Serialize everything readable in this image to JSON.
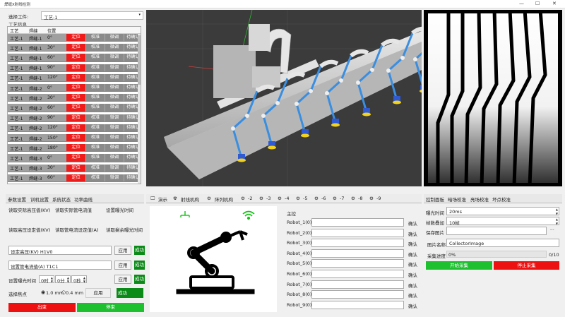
{
  "window": {
    "title": "焊缝X射线检测",
    "min": "—",
    "max": "☐",
    "close": "✕"
  },
  "left": {
    "select_label": "选择工件:",
    "workpiece": "工艺-1",
    "info_label": "工艺信息",
    "headers": [
      "工艺",
      "焊缝",
      "位置"
    ],
    "action_labels": [
      "定位",
      "校准",
      "微调",
      "待确认"
    ],
    "rows": [
      [
        "工艺-1",
        "焊缝-1",
        "0°"
      ],
      [
        "工艺-1",
        "焊缝-1",
        "30°"
      ],
      [
        "工艺-1",
        "焊缝-1",
        "60°"
      ],
      [
        "工艺-1",
        "焊缝-1",
        "90°"
      ],
      [
        "工艺-1",
        "焊缝-1",
        "120°"
      ],
      [
        "工艺-1",
        "焊缝-2",
        "0°"
      ],
      [
        "工艺-1",
        "焊缝-2",
        "30°"
      ],
      [
        "工艺-1",
        "焊缝-2",
        "60°"
      ],
      [
        "工艺-1",
        "焊缝-2",
        "90°"
      ],
      [
        "工艺-1",
        "焊缝-2",
        "120°"
      ],
      [
        "工艺-1",
        "焊缝-2",
        "150°"
      ],
      [
        "工艺-1",
        "焊缝-2",
        "180°"
      ],
      [
        "工艺-1",
        "焊缝-3",
        "0°"
      ],
      [
        "工艺-1",
        "焊缝-3",
        "30°"
      ],
      [
        "工艺-1",
        "焊缝-3",
        "60°"
      ]
    ]
  },
  "params": {
    "tabs": [
      "参数设置",
      "训机设置",
      "系统状态",
      "功率曲线"
    ],
    "read_labels": [
      "读取实际高压值(KV)",
      "读取实际管电流值",
      "设置曝光时间",
      "读取高压设定值(KV)",
      "读取管电流设定值(A)",
      "读取剩余曝光时间"
    ],
    "set_voltage_label": "设定高压(KV) H1V0",
    "set_current_label": "设置管电流值(A) T1C1",
    "apply": "应用",
    "success": "成功",
    "exposure_label": "设置曝光时间",
    "exposure_h": "0时",
    "exposure_m": "0分",
    "exposure_s": "0秒",
    "focus_label": "选择焦点",
    "focus_opt1": "1.0 mm",
    "focus_opt2": "0.4 mm",
    "btn_start": "出束",
    "btn_stop": "停束"
  },
  "mid": {
    "tabs": [
      "演示",
      "射线机构",
      "阵列机构",
      "-2",
      "-3",
      "-4",
      "-5",
      "-6",
      "-7",
      "-8",
      "-9"
    ],
    "master_label": "主控",
    "robots": [
      "Robot_1(0)",
      "Robot_2(0)",
      "Robot_3(0)",
      "Robot_4(0)",
      "Robot_5(0)",
      "Robot_6(0)",
      "Robot_7(0)",
      "Robot_8(0)",
      "Robot_9(0)"
    ],
    "confirm": "确认"
  },
  "right": {
    "tabs": [
      "控制面板",
      "暗场校准",
      "亮场校准",
      "坏点校准"
    ],
    "exposure_label": "曝光时间",
    "exposure_val": "20ms",
    "frames_label": "帧数叠加",
    "frames_val": "10帧",
    "save_label": "保存图片",
    "browse": "···",
    "name_label": "图片名称",
    "name_val": "CollectorImage",
    "progress_label": "采集进度",
    "progress_text": "0%",
    "progress_count": "0/10",
    "btn_start": "开始采集",
    "btn_stop": "停止采集"
  },
  "colors": {
    "accent_red": "#ef1a1a",
    "accent_green": "#1ec030",
    "wifi_green": "#13c313"
  }
}
